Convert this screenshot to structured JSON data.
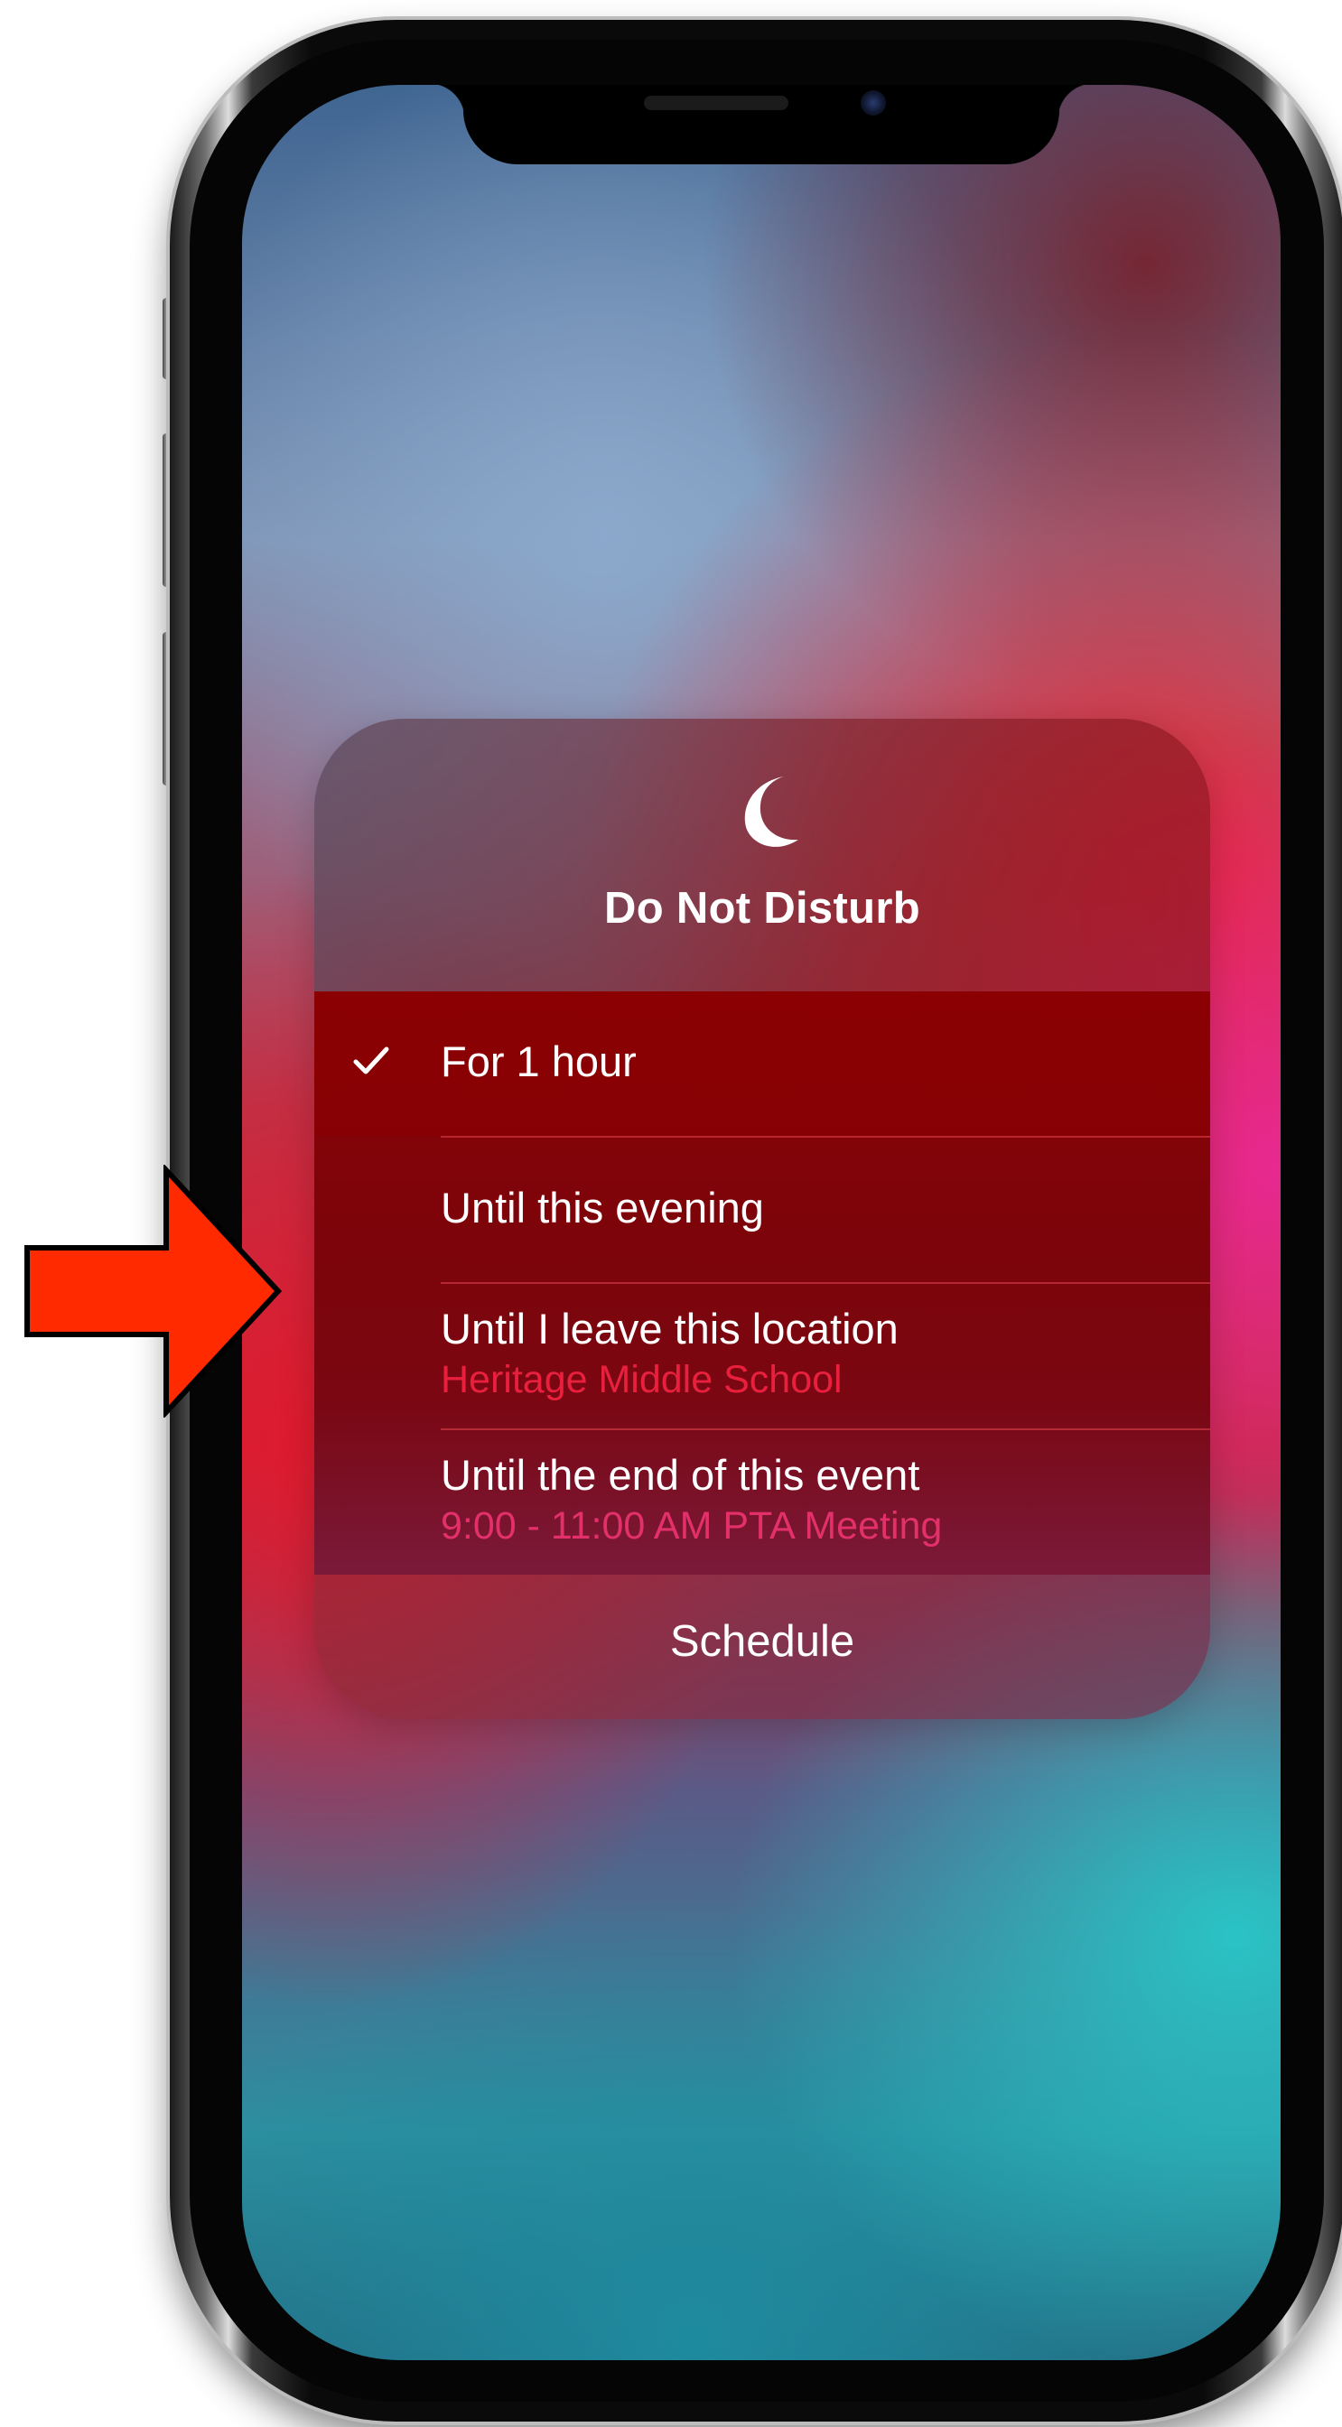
{
  "dnd": {
    "title": "Do Not Disturb",
    "icon": "moon-icon",
    "options": [
      {
        "label": "For 1 hour",
        "sublabel": "",
        "selected": true
      },
      {
        "label": "Until this evening",
        "sublabel": "",
        "selected": false
      },
      {
        "label": "Until I leave this location",
        "sublabel": "Heritage Middle School",
        "selected": false
      },
      {
        "label": "Until the end of this event",
        "sublabel": "9:00 - 11:00 AM PTA Meeting",
        "selected": false
      }
    ],
    "schedule_label": "Schedule"
  },
  "colors": {
    "accent_red": "#e8203e",
    "arrow_red": "#ff2a00",
    "text": "#ffffff"
  },
  "annotation": {
    "arrow_icon": "arrow-right-icon"
  }
}
